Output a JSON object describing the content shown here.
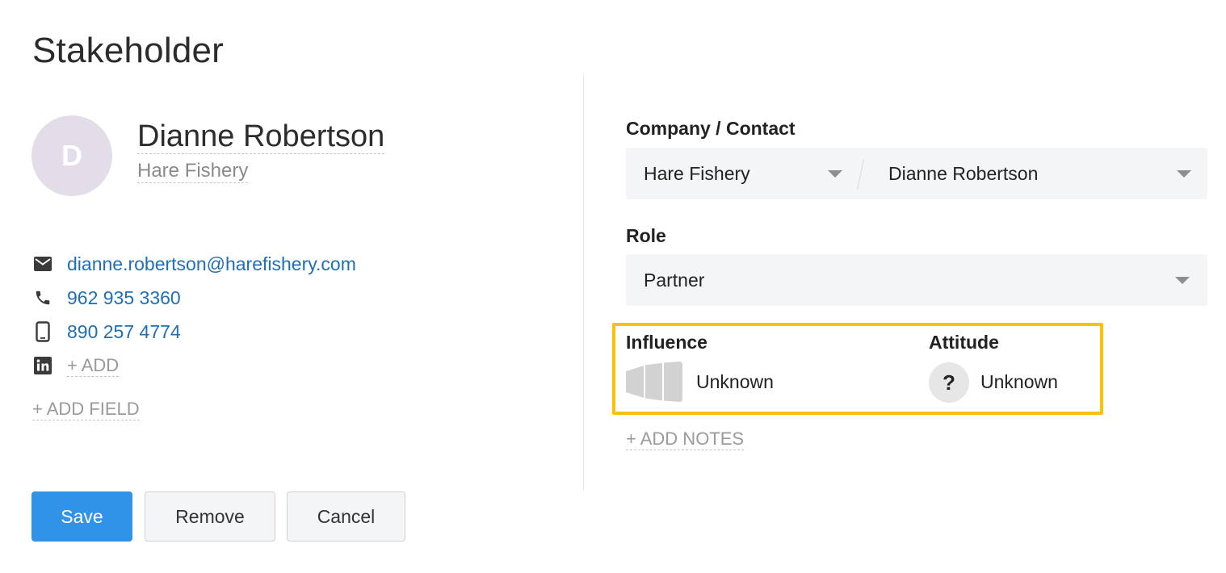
{
  "page": {
    "title": "Stakeholder"
  },
  "person": {
    "initial": "D",
    "name": "Dianne Robertson",
    "company": "Hare Fishery"
  },
  "contacts": {
    "email": "dianne.robertson@harefishery.com",
    "phone": "962 935 3360",
    "mobile": "890 257 4774",
    "linkedin_add": "+ ADD",
    "add_field": "+ ADD FIELD"
  },
  "form": {
    "company_contact_label": "Company / Contact",
    "company_value": "Hare Fishery",
    "contact_value": "Dianne Robertson",
    "role_label": "Role",
    "role_value": "Partner",
    "influence_label": "Influence",
    "influence_value": "Unknown",
    "attitude_label": "Attitude",
    "attitude_value": "Unknown",
    "attitude_symbol": "?",
    "add_notes": "+ ADD NOTES"
  },
  "buttons": {
    "save": "Save",
    "remove": "Remove",
    "cancel": "Cancel"
  },
  "colors": {
    "primary": "#3193e8",
    "link": "#1f6fb6",
    "highlight": "#ffc107",
    "avatar_bg": "#e2dde8"
  },
  "icons": {
    "email": "email-icon",
    "phone": "phone-icon",
    "mobile": "mobile-icon",
    "linkedin": "linkedin-icon",
    "influence": "influence-bars-icon",
    "attitude": "question-icon",
    "dropdown": "chevron-down-icon"
  }
}
